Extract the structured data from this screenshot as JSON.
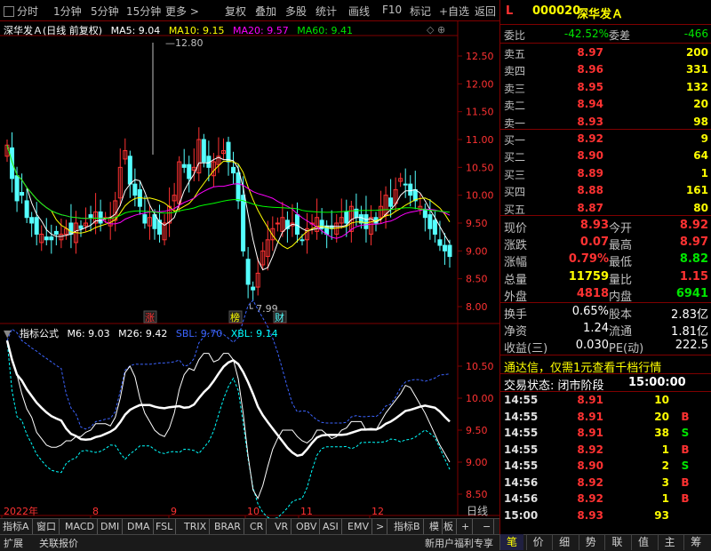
{
  "toolbar": {
    "items": [
      "分时",
      "1分钟",
      "5分钟",
      "15分钟",
      "更多",
      "复权",
      "叠加",
      "多股",
      "统计",
      "画线",
      "F10",
      "标记",
      "+自选",
      "返回"
    ]
  },
  "chart": {
    "stock_title": "深华发Ａ(日线 前复权)",
    "ma5": "MA5: 9.04",
    "ma10": "MA10: 9.15",
    "ma20": "MA20: 9.57",
    "ma60": "MA60: 9.41",
    "high_marker": "12.80",
    "low_marker": "7.99",
    "event_labels": [
      "涨",
      "榜",
      "财"
    ],
    "indicator_name": "指标公式",
    "m6": "M6: 9.03",
    "m26": "M26: 9.42",
    "sbl": "SBL: 9.70",
    "xbl": "XBL: 9.14",
    "price_ticks": [
      "12.50",
      "12.00",
      "11.50",
      "11.00",
      "10.50",
      "10.00",
      "9.50",
      "9.00",
      "8.50",
      "8.00"
    ],
    "ind_ticks": [
      "10.50",
      "10.00",
      "9.50",
      "9.00",
      "8.50"
    ],
    "dates": [
      "2022年",
      "8",
      "9",
      "10",
      "11",
      "12"
    ],
    "period_label": "日线",
    "colors": {
      "ma5": "#ffffff",
      "ma10": "#ffff00",
      "ma20": "#ff00ff",
      "ma60": "#00ff00",
      "up": "#ff3232",
      "down": "#54ffff"
    }
  },
  "indicator_tabs": [
    "指标A",
    "窗口",
    "MACD",
    "DMI",
    "DMA",
    "FSL",
    "TRIX",
    "BRAR",
    "CR",
    "VR",
    "OBV",
    "ASI",
    "EMV",
    ">",
    "指标B",
    "模",
    "板",
    "+",
    "−"
  ],
  "statusbar": {
    "left": [
      "扩展",
      "关联报价"
    ],
    "promo": "新用户福利专享",
    "tabs": [
      "笔",
      "价",
      "细",
      "势",
      "联",
      "值",
      "主",
      "筹"
    ]
  },
  "quote": {
    "flag": "L",
    "code": "000020",
    "name": "深华发Ａ",
    "weibi_label": "委比",
    "weibi": "-42.52%",
    "weicha_label": "委差",
    "weicha": "-466",
    "asks": [
      {
        "label": "卖五",
        "price": "8.97",
        "vol": "200"
      },
      {
        "label": "卖四",
        "price": "8.96",
        "vol": "331"
      },
      {
        "label": "卖三",
        "price": "8.95",
        "vol": "132"
      },
      {
        "label": "卖二",
        "price": "8.94",
        "vol": "20"
      },
      {
        "label": "卖一",
        "price": "8.93",
        "vol": "98"
      }
    ],
    "bids": [
      {
        "label": "买一",
        "price": "8.92",
        "vol": "9"
      },
      {
        "label": "买二",
        "price": "8.90",
        "vol": "64"
      },
      {
        "label": "买三",
        "price": "8.89",
        "vol": "1"
      },
      {
        "label": "买四",
        "price": "8.88",
        "vol": "161"
      },
      {
        "label": "买五",
        "price": "8.87",
        "vol": "80"
      }
    ],
    "stats": [
      {
        "l1": "现价",
        "v1": "8.93",
        "c1": "red",
        "l2": "今开",
        "v2": "8.92",
        "c2": "red"
      },
      {
        "l1": "涨跌",
        "v1": "0.07",
        "c1": "red",
        "l2": "最高",
        "v2": "8.97",
        "c2": "red"
      },
      {
        "l1": "涨幅",
        "v1": "0.79%",
        "c1": "red",
        "l2": "最低",
        "v2": "8.82",
        "c2": "green"
      },
      {
        "l1": "总量",
        "v1": "11759",
        "c1": "yellow",
        "l2": "量比",
        "v2": "1.15",
        "c2": "red"
      },
      {
        "l1": "外盘",
        "v1": "4818",
        "c1": "red",
        "l2": "内盘",
        "v2": "6941",
        "c2": "green"
      }
    ],
    "stats2": [
      {
        "l1": "换手",
        "v1": "0.65%",
        "l2": "股本",
        "v2": "2.83亿"
      },
      {
        "l1": "净资",
        "v1": "1.24",
        "l2": "流通",
        "v2": "1.81亿"
      },
      {
        "l1": "收益(三)",
        "v1": "0.030",
        "l2": "PE(动)",
        "v2": "222.5"
      }
    ],
    "promo": "通达信，仅需1元查看千档行情",
    "status_label": "交易状态: 闭市阶段",
    "status_time": "15:00:00",
    "ticks": [
      {
        "t": "14:55",
        "p": "8.91",
        "v": "10",
        "d": "",
        "pc": "red"
      },
      {
        "t": "14:55",
        "p": "8.91",
        "v": "20",
        "d": "B",
        "pc": "red"
      },
      {
        "t": "14:55",
        "p": "8.91",
        "v": "38",
        "d": "S",
        "pc": "red"
      },
      {
        "t": "14:55",
        "p": "8.92",
        "v": "1",
        "d": "B",
        "pc": "red"
      },
      {
        "t": "14:55",
        "p": "8.90",
        "v": "2",
        "d": "S",
        "pc": "red"
      },
      {
        "t": "14:56",
        "p": "8.92",
        "v": "3",
        "d": "B",
        "pc": "red"
      },
      {
        "t": "14:56",
        "p": "8.92",
        "v": "1",
        "d": "B",
        "pc": "red"
      },
      {
        "t": "15:00",
        "p": "8.93",
        "v": "93",
        "d": "",
        "pc": "red"
      }
    ]
  }
}
